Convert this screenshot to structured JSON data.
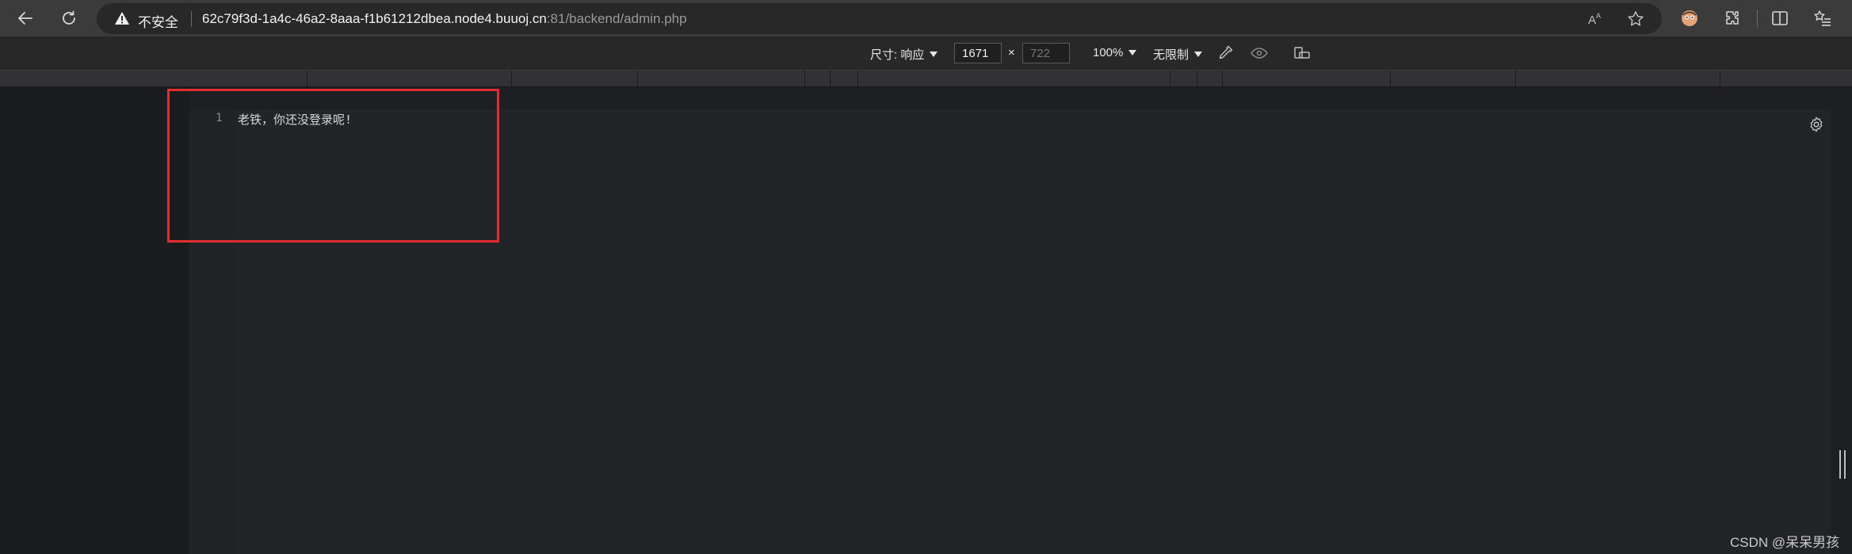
{
  "browser": {
    "security_label": "不安全",
    "url_host": "62c79f3d-1a4c-46a2-8aaa-f1b61212dbea.node4.buuoj.cn",
    "url_path": ":81/backend/admin.php"
  },
  "device_toolbar": {
    "dimensions_label": "尺寸: 响应",
    "width_value": "1671",
    "times_sign": "×",
    "height_placeholder": "722",
    "zoom": "100%",
    "throttling": "无限制"
  },
  "source_view": {
    "line_number": "1",
    "line_text": "老铁，你还没登录呢!"
  },
  "watermark": "CSDN @呆呆男孩",
  "colors": {
    "highlight_border": "#e02d2d",
    "background": "#1e1f22"
  },
  "icons": [
    "back-arrow-icon",
    "reload-icon",
    "warning-icon",
    "read-aloud-icon",
    "favorite-star-icon",
    "profile-avatar-icon",
    "extensions-icon",
    "split-screen-icon",
    "favorites-list-icon",
    "caret-down-icon",
    "eyedropper-icon",
    "eye-icon",
    "device-rotate-icon",
    "settings-gear-icon"
  ]
}
